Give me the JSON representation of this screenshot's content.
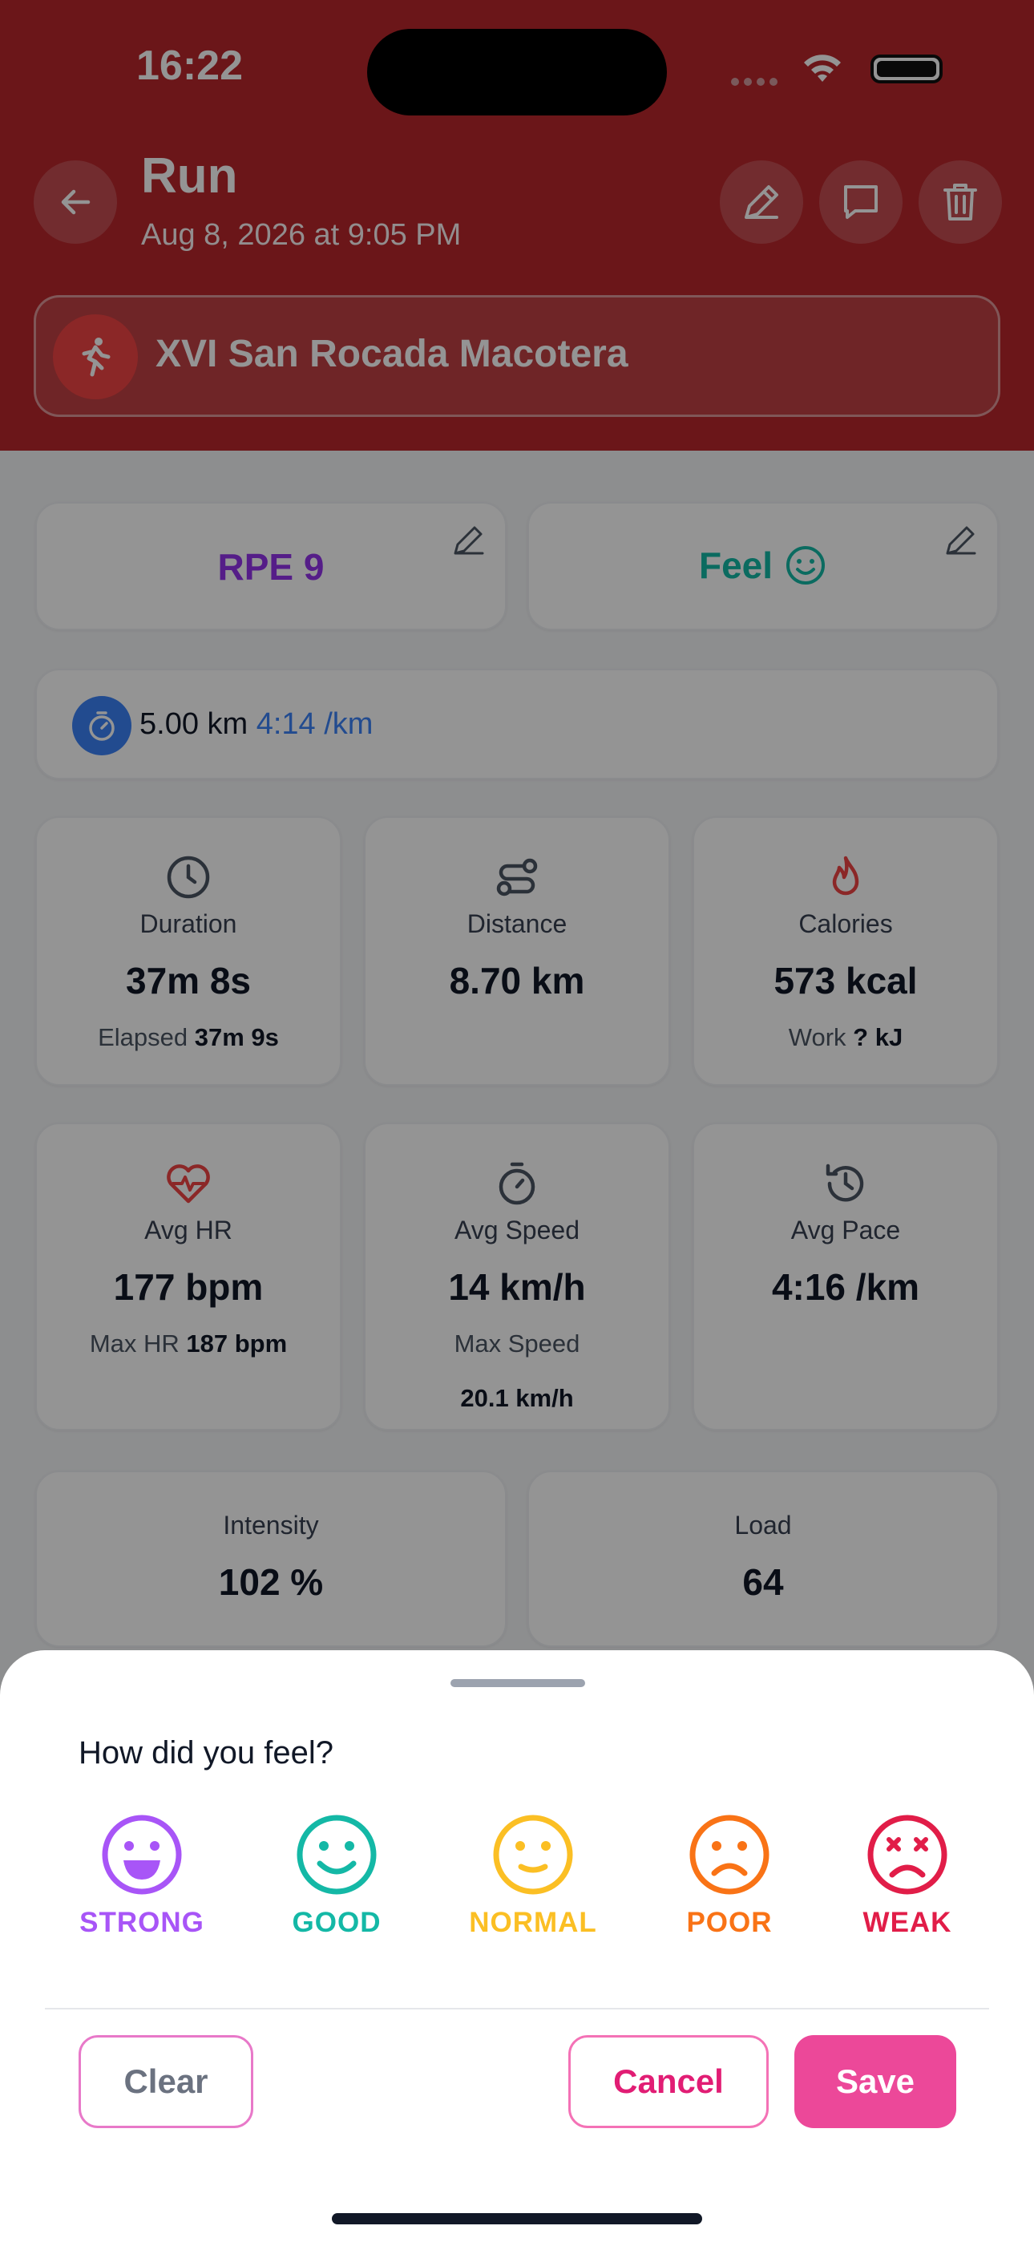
{
  "status_bar": {
    "time": "16:22"
  },
  "header": {
    "title": "Run",
    "subtitle": "Aug 8, 2026 at 9:05 PM",
    "event_name": "XVI San Rocada Macotera",
    "icons": [
      "back-arrow-icon",
      "pencil-icon",
      "comment-icon",
      "trash-icon",
      "runner-icon"
    ]
  },
  "rating": {
    "rpe_label": "RPE 9",
    "feel_label": "Feel"
  },
  "split": {
    "distance": "5.00 km",
    "pace": "4:14 /km"
  },
  "stats": {
    "duration": {
      "label": "Duration",
      "value": "37m 8s",
      "sub_label": "Elapsed",
      "sub_value": "37m 9s"
    },
    "distance": {
      "label": "Distance",
      "value": "8.70 km"
    },
    "calories": {
      "label": "Calories",
      "value": "573 kcal",
      "sub_label": "Work",
      "sub_value": "? kJ"
    },
    "avg_hr": {
      "label": "Avg HR",
      "value": "177 bpm",
      "sub_label": "Max HR",
      "sub_value": "187 bpm"
    },
    "avg_speed": {
      "label": "Avg Speed",
      "value": "14 km/h",
      "sub_label": "Max Speed",
      "sub_value": "20.1 km/h"
    },
    "avg_pace": {
      "label": "Avg Pace",
      "value": "4:16 /km"
    },
    "intensity": {
      "label": "Intensity",
      "value": "102 %"
    },
    "load": {
      "label": "Load",
      "value": "64"
    }
  },
  "sheet": {
    "question": "How did you feel?",
    "options": [
      {
        "label": "STRONG",
        "color": "#a855f7",
        "icon": "grin-icon"
      },
      {
        "label": "GOOD",
        "color": "#14b8a6",
        "icon": "smile-icon"
      },
      {
        "label": "NORMAL",
        "color": "#fbbf24",
        "icon": "neutral-smile-icon"
      },
      {
        "label": "POOR",
        "color": "#f97316",
        "icon": "frown-icon"
      },
      {
        "label": "WEAK",
        "color": "#e11d48",
        "icon": "dizzy-face-icon"
      }
    ],
    "clear_label": "Clear",
    "cancel_label": "Cancel",
    "save_label": "Save"
  },
  "colors": {
    "header": "#b8262b",
    "accent_pink": "#ec4899",
    "rpe_purple": "#9333ea",
    "feel_teal": "#14b8a6",
    "split_blue": "#3b82f6"
  }
}
